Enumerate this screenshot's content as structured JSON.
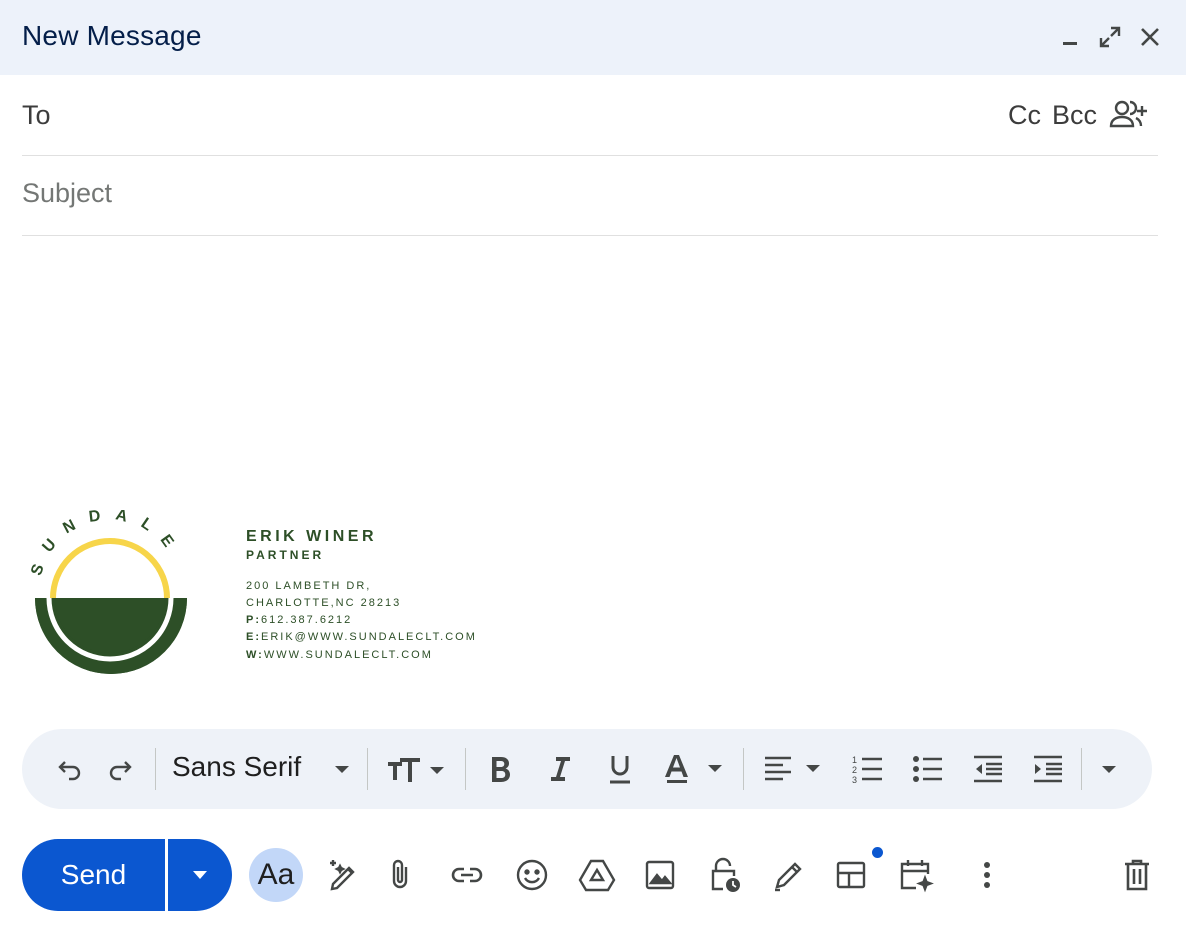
{
  "window": {
    "title": "New Message",
    "controls": [
      "minimize-icon",
      "expand-icon",
      "close-icon"
    ]
  },
  "recipients": {
    "to_label": "To",
    "cc_label": "Cc",
    "bcc_label": "Bcc",
    "add_recipients_icon": "person-add-icon"
  },
  "subject": {
    "placeholder": "Subject",
    "value": ""
  },
  "signature": {
    "logo_text": "SUNDALE",
    "name": "ERIK WINER",
    "role": "PARTNER",
    "address_line1": "200 LAMBETH DR,",
    "address_line2": "CHARLOTTE,NC 28213",
    "phone_prefix": "P:",
    "phone": "612.387.6212",
    "email_prefix": "E:",
    "email": "ERIK@WWW.SUNDALECLT.COM",
    "web_prefix": "W:",
    "web": "WWW.SUNDALECLT.COM",
    "colors": {
      "green": "#2d4f27",
      "yellow": "#f7d54a"
    }
  },
  "formatting": {
    "font_name": "Sans Serif",
    "icons": [
      "undo-icon",
      "redo-icon",
      "text-size-icon",
      "bold-icon",
      "italic-icon",
      "underline-icon",
      "text-color-icon",
      "align-icon",
      "numbered-list-icon",
      "bulleted-list-icon",
      "indent-less-icon",
      "indent-more-icon",
      "more-formatting-icon"
    ]
  },
  "bottom_toolbar": {
    "send_label": "Send",
    "formatting_toggle_label": "Aa",
    "icons": [
      "help-me-write-icon",
      "attach-icon",
      "link-icon",
      "emoji-icon",
      "drive-icon",
      "photo-icon",
      "confidential-icon",
      "signature-icon",
      "layouts-icon",
      "schedule-icon",
      "more-options-icon",
      "discard-icon"
    ]
  },
  "colors": {
    "header_bg": "#edf2fa",
    "title": "#041e49",
    "accent": "#0b57d0",
    "format_bar_bg": "#eef2f8",
    "aa_bg": "#c2d7f8"
  }
}
